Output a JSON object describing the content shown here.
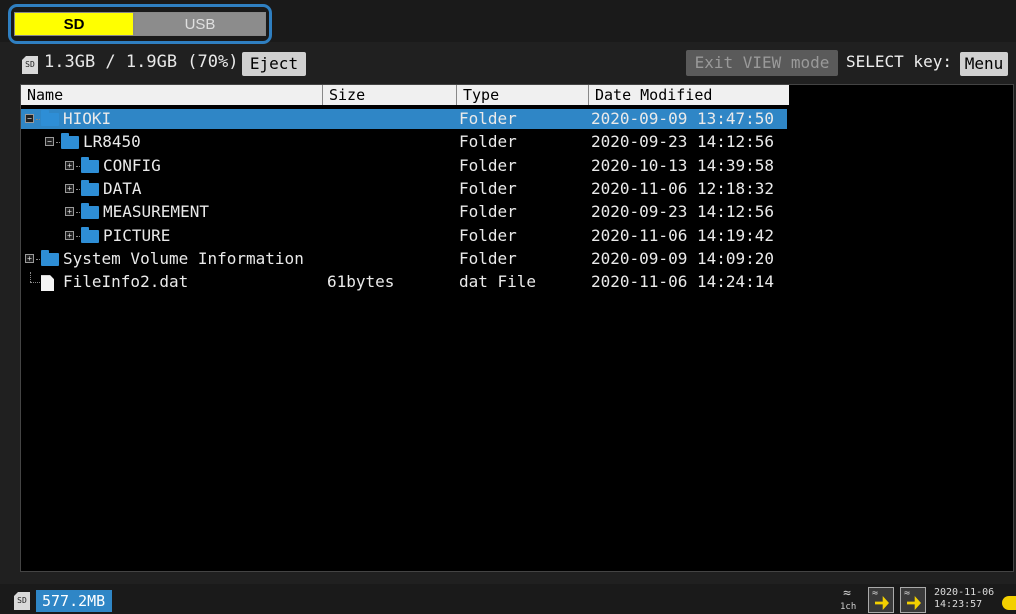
{
  "tabs": [
    {
      "label": "SD",
      "active": true
    },
    {
      "label": "USB",
      "active": false
    }
  ],
  "storage": {
    "icon_text": "SD",
    "usage_text": "1.3GB / 1.9GB (70%)"
  },
  "toolbar": {
    "eject_label": "Eject",
    "exit_view_label": "Exit VIEW mode",
    "select_key_label": "SELECT key:",
    "menu_label": "Menu"
  },
  "columns": [
    "Name",
    "Size",
    "Type",
    "Date Modified"
  ],
  "rows": [
    {
      "name": "HIOKI",
      "size": "",
      "type": "Folder",
      "date": "2020-09-09 13:47:50",
      "kind": "folder",
      "level": 0,
      "expander": "minus",
      "selected": true
    },
    {
      "name": "LR8450",
      "size": "",
      "type": "Folder",
      "date": "2020-09-23 14:12:56",
      "kind": "folder",
      "level": 1,
      "expander": "minus",
      "selected": false
    },
    {
      "name": "CONFIG",
      "size": "",
      "type": "Folder",
      "date": "2020-10-13 14:39:58",
      "kind": "folder",
      "level": 2,
      "expander": "plus",
      "selected": false
    },
    {
      "name": "DATA",
      "size": "",
      "type": "Folder",
      "date": "2020-11-06 12:18:32",
      "kind": "folder",
      "level": 2,
      "expander": "plus",
      "selected": false
    },
    {
      "name": "MEASUREMENT",
      "size": "",
      "type": "Folder",
      "date": "2020-09-23 14:12:56",
      "kind": "folder",
      "level": 2,
      "expander": "plus",
      "selected": false
    },
    {
      "name": "PICTURE",
      "size": "",
      "type": "Folder",
      "date": "2020-11-06 14:19:42",
      "kind": "folder",
      "level": 2,
      "expander": "plus",
      "selected": false
    },
    {
      "name": "System Volume Information",
      "size": "",
      "type": "Folder",
      "date": "2020-09-09 14:09:20",
      "kind": "folder",
      "level": 0,
      "expander": "plus",
      "selected": false
    },
    {
      "name": "FileInfo2.dat",
      "size": "61bytes",
      "type": "dat File",
      "date": "2020-11-06 14:24:14",
      "kind": "file",
      "level": 0,
      "expander": "none",
      "selected": false
    }
  ],
  "status": {
    "sd_icon_text": "SD",
    "free_space": "577.2MB",
    "channel_label": "1ch",
    "date": "2020-11-06",
    "time": "14:23:57"
  },
  "colors": {
    "sd_tab": "#ffff00",
    "usb_tab": "#8c8c8c",
    "selection": "#2f86c6",
    "folder": "#2e8ed6",
    "highlight_outline": "#2f7fc1"
  }
}
